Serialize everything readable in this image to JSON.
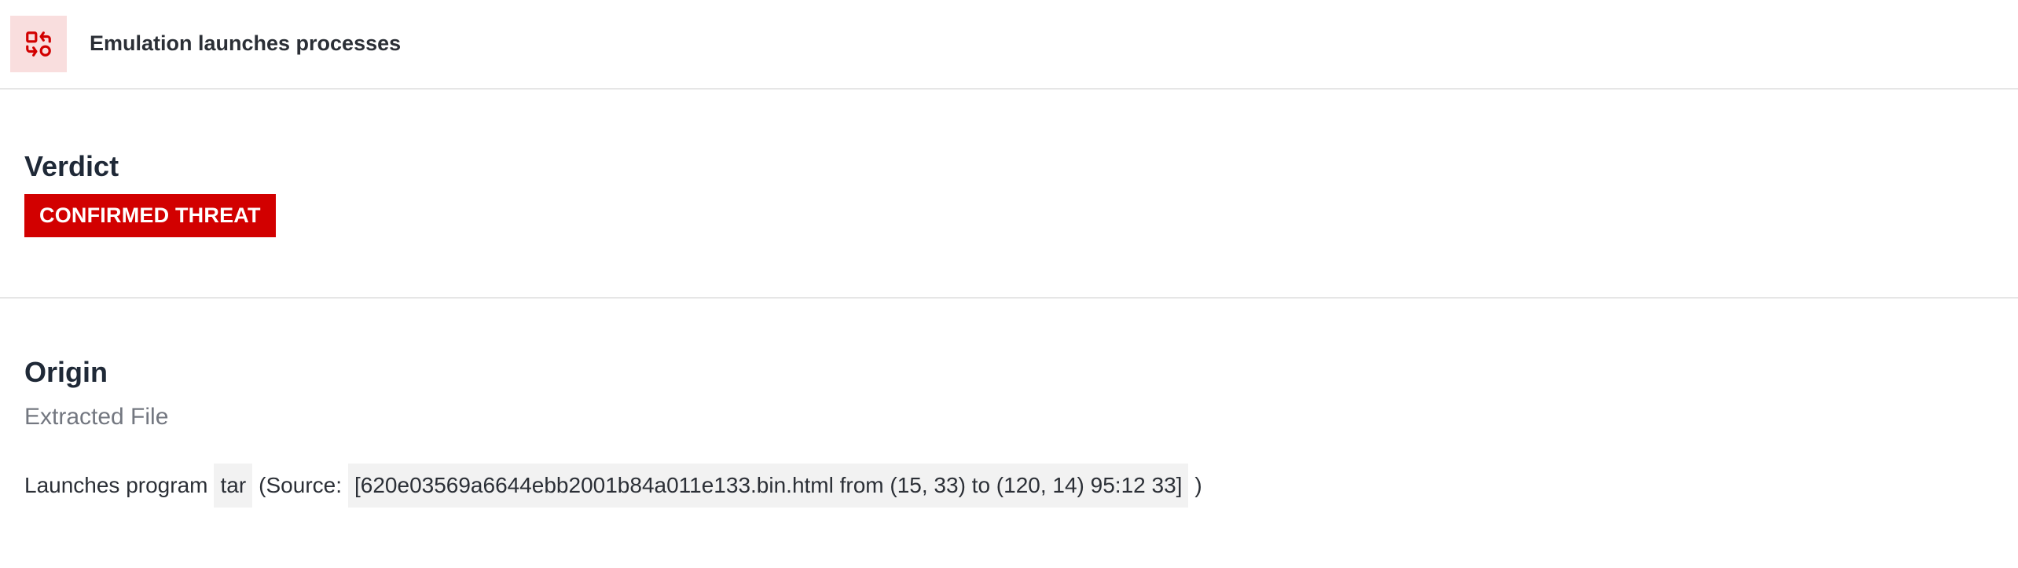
{
  "header": {
    "title": "Emulation launches processes",
    "icon": "process-swap-icon",
    "accent_color": "#d20000",
    "icon_bg_color": "#f9dede"
  },
  "verdict": {
    "heading": "Verdict",
    "badge": "CONFIRMED THREAT",
    "badge_color": "#d20000"
  },
  "origin": {
    "heading": "Origin",
    "subtitle": "Extracted File",
    "launch_prefix": "Launches program",
    "program": "tar",
    "source_prefix": "(Source:",
    "source_value": "[620e03569a6644ebb2001b84a011e133.bin.html from (15, 33) to (120, 14) 95:12 33]",
    "source_suffix": ")"
  }
}
